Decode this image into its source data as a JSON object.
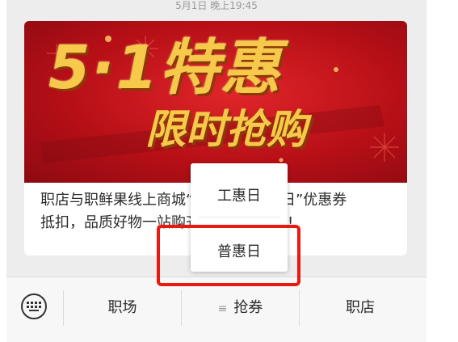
{
  "chat": {
    "timestamp": "5月1日 晚上19:45"
  },
  "article": {
    "banner_line1": "5·1特惠",
    "banner_line2": "限时抢购",
    "description_line1": "职店与职鲜果线上商城“工惠日”“普惠日”优惠券",
    "description_line2": "抵扣，品质好物一站购齐，快来看看吧!"
  },
  "bottom_menu": {
    "items": [
      {
        "label": "职场"
      },
      {
        "label": "抢券"
      },
      {
        "label": "职店"
      }
    ]
  },
  "submenu": {
    "items": [
      {
        "label": "工惠日"
      },
      {
        "label": "普惠日"
      }
    ]
  },
  "colors": {
    "banner_red": "#c4161c",
    "gold_text": "#f6c94a",
    "highlight_red": "#e8190f"
  }
}
